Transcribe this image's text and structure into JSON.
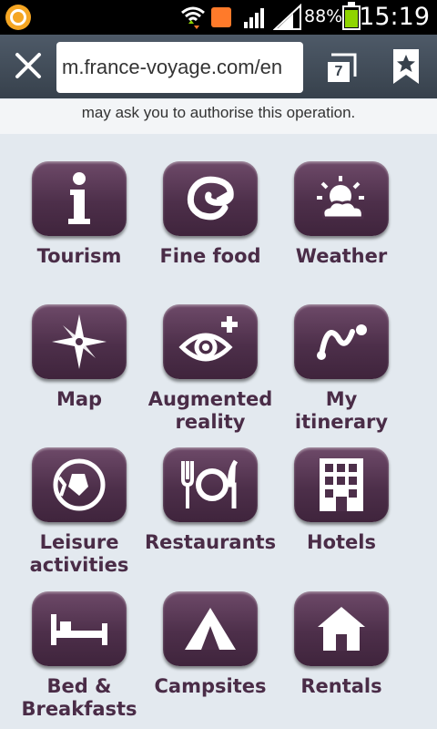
{
  "status_bar": {
    "battery_percent": "88%",
    "time": "15:19"
  },
  "browser": {
    "url": "m.france-voyage.com/en",
    "tab_count": "7",
    "load_progress": 0.85
  },
  "notice": {
    "text": "may ask you to authorise this operation."
  },
  "tiles": [
    {
      "label": "Tourism",
      "icon": "info-icon"
    },
    {
      "label": "Fine food",
      "icon": "swirl-icon"
    },
    {
      "label": "Weather",
      "icon": "sun-cloud-icon"
    },
    {
      "label": "Map",
      "icon": "compass-rose-icon"
    },
    {
      "label": "Augmented reality",
      "icon": "eye-plus-icon"
    },
    {
      "label": "My itinerary",
      "icon": "route-icon"
    },
    {
      "label": "Leisure activities",
      "icon": "football-icon"
    },
    {
      "label": "Restaurants",
      "icon": "cutlery-plate-icon"
    },
    {
      "label": "Hotels",
      "icon": "building-icon"
    },
    {
      "label": "Bed & Breakfasts",
      "icon": "bed-icon"
    },
    {
      "label": "Campsites",
      "icon": "tent-icon"
    },
    {
      "label": "Rentals",
      "icon": "house-icon"
    }
  ],
  "colors": {
    "tile": "#4d2f4a",
    "label": "#4a2c47",
    "background": "#e3e9ef"
  }
}
